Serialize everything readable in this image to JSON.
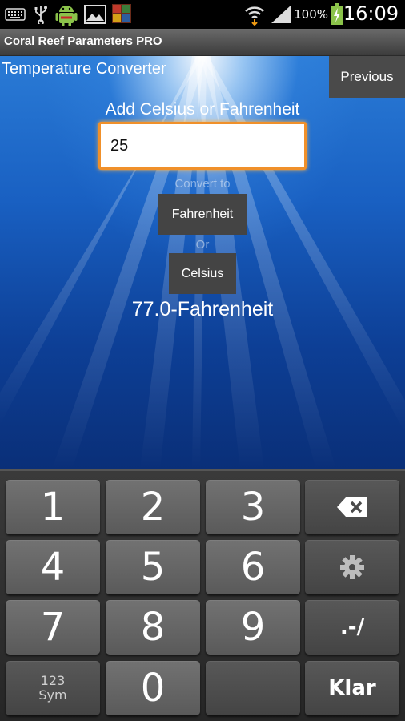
{
  "status_bar": {
    "battery_percent": "100%",
    "time": "16:09"
  },
  "app": {
    "title": "Coral Reef Parameters PRO"
  },
  "screen": {
    "title": "Temperature Converter",
    "previous_button": "Previous",
    "input_label": "Add Celsius or Fahrenheit",
    "input_value": "25",
    "convert_label": "Convert to",
    "fahrenheit_button": "Fahrenheit",
    "or_label": "Or",
    "celsius_button": "Celsius",
    "result": "77.0-Fahrenheit"
  },
  "keyboard": {
    "keys": {
      "k1": "1",
      "k2": "2",
      "k3": "3",
      "k4": "4",
      "k5": "5",
      "k6": "6",
      "k7": "7",
      "k8": "8",
      "k9": "9",
      "k0": "0",
      "sym_top": "123",
      "sym_bottom": "Sym",
      "punct": ".-/",
      "enter": "Klar"
    }
  }
}
